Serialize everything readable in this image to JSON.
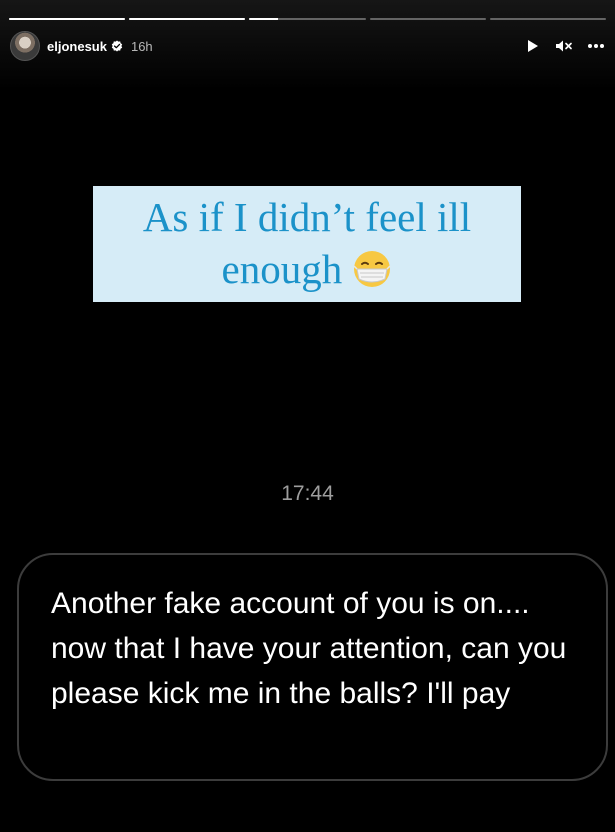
{
  "story": {
    "progress": [
      1,
      1,
      0.25,
      0,
      0
    ],
    "username": "eljonesuk",
    "posted_ago": "16h"
  },
  "icons": {
    "avatar": "profile-avatar",
    "verified": "verified-badge-icon",
    "play": "play-icon",
    "mute": "muted-speaker-icon",
    "more": "more-options-icon"
  },
  "caption": {
    "text": "As if I didn’t feel ill enough",
    "emoji": "face-with-medical-mask",
    "background": "#d6ecf7",
    "color": "#1b92c9"
  },
  "message": {
    "time": "17:44",
    "text": "Another fake account of you is on.... now that I have your attention, can you please kick me in the balls? I'll pay"
  }
}
